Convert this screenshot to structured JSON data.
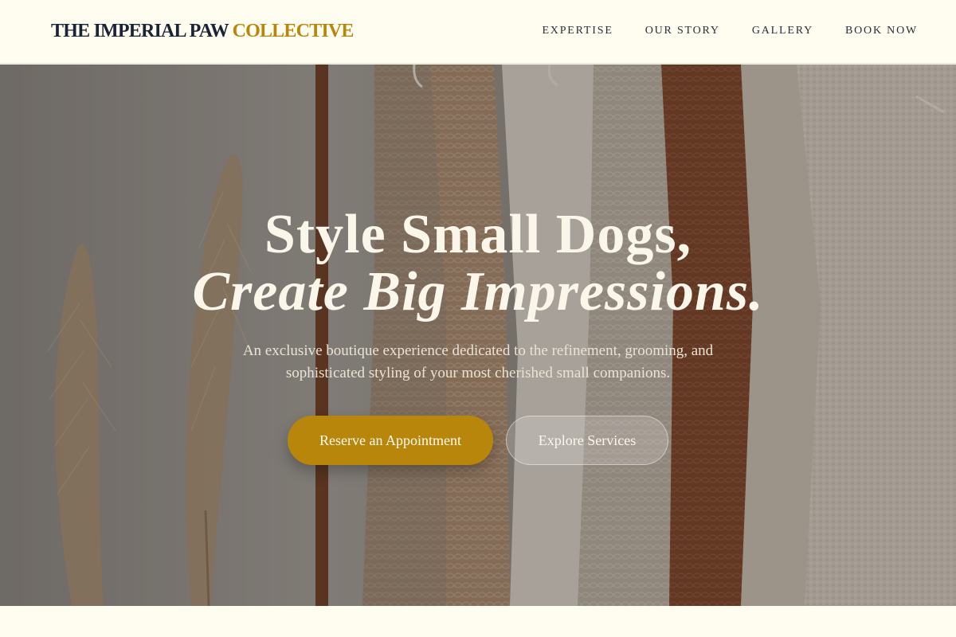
{
  "brand": {
    "name": "THE IMPERIAL PAW",
    "accent": "COLLECTIVE"
  },
  "nav": {
    "items": [
      "EXPERTISE",
      "OUR STORY",
      "GALLERY",
      "BOOK NOW"
    ]
  },
  "hero": {
    "headline_line1": "Style Small Dogs,",
    "headline_line2": "Create Big Impressions.",
    "subtitle": "An exclusive boutique experience dedicated to the refinement, grooming, and sophisticated styling of your most cherished small companions.",
    "primary_button": "Reserve an Appointment",
    "secondary_button": "Explore Services"
  },
  "colors": {
    "accent": "#b8860b",
    "navy": "#1b2436",
    "cream": "#fffdf0"
  }
}
